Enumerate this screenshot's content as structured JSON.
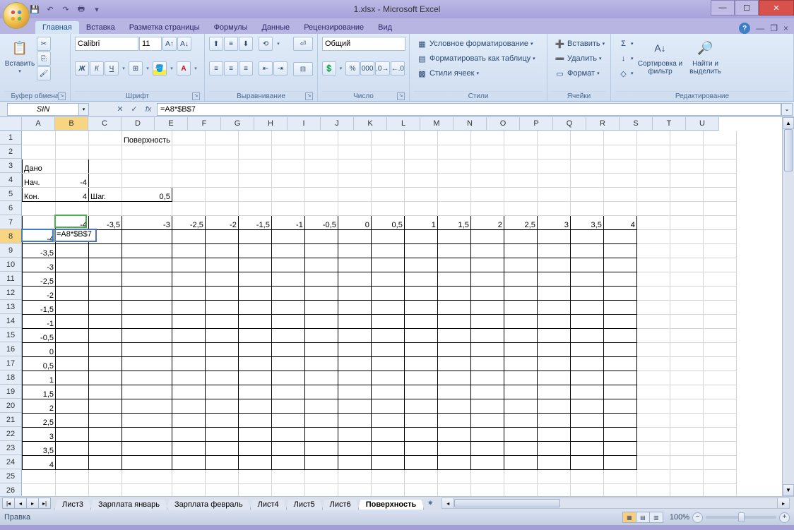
{
  "title": "1.xlsx - Microsoft Excel",
  "tabs": {
    "home": "Главная",
    "insert": "Вставка",
    "layout": "Разметка страницы",
    "formulas": "Формулы",
    "data": "Данные",
    "review": "Рецензирование",
    "view": "Вид"
  },
  "ribbon": {
    "clipboard": {
      "paste": "Вставить",
      "label": "Буфер обмена"
    },
    "font": {
      "name": "Calibri",
      "size": "11",
      "label": "Шрифт"
    },
    "align": {
      "label": "Выравнивание"
    },
    "number": {
      "format": "Общий",
      "label": "Число"
    },
    "styles": {
      "cond": "Условное форматирование",
      "table": "Форматировать как таблицу",
      "cell": "Стили ячеек",
      "label": "Стили"
    },
    "cells": {
      "insert": "Вставить",
      "delete": "Удалить",
      "format": "Формат",
      "label": "Ячейки"
    },
    "editing": {
      "sort": "Сортировка и фильтр",
      "find": "Найти и выделить",
      "label": "Редактирование"
    }
  },
  "nameBox": "SIN",
  "formula": "=A8*$B$7",
  "columns": [
    "A",
    "B",
    "C",
    "D",
    "E",
    "F",
    "G",
    "H",
    "I",
    "J",
    "K",
    "L",
    "M",
    "N",
    "O",
    "P",
    "Q",
    "R",
    "S",
    "T",
    "U"
  ],
  "rows": [
    "1",
    "2",
    "3",
    "4",
    "5",
    "6",
    "7",
    "8",
    "9",
    "10",
    "11",
    "12",
    "13",
    "14",
    "15",
    "16",
    "17",
    "18",
    "19",
    "20",
    "21",
    "22",
    "23",
    "24",
    "25",
    "26"
  ],
  "cellData": {
    "title": "Поверхность",
    "given": "Дано",
    "startLbl": "Нач.",
    "startVal": "-4",
    "endLbl": "Кон.",
    "endVal": "4",
    "stepLbl": "Шаг.",
    "stepVal": "0,5",
    "row7": [
      "-4",
      "-3,5",
      "-3",
      "-2,5",
      "-2",
      "-1,5",
      "-1",
      "-0,5",
      "0",
      "0,5",
      "1",
      "1,5",
      "2",
      "2,5",
      "3",
      "3,5",
      "4"
    ],
    "colA": [
      "-4",
      "-3,5",
      "-3",
      "-2,5",
      "-2",
      "-1,5",
      "-1",
      "-0,5",
      "0",
      "0,5",
      "1",
      "1,5",
      "2",
      "2,5",
      "3",
      "3,5",
      "4"
    ],
    "editValue": "=A8*$B$7"
  },
  "sheettabs": [
    "Лист3",
    "Зарплата январь",
    "Зарплата февраль",
    "Лист4",
    "Лист5",
    "Лист6",
    "Поверхность"
  ],
  "activeSheetIndex": 6,
  "status": "Правка",
  "zoom": "100%"
}
